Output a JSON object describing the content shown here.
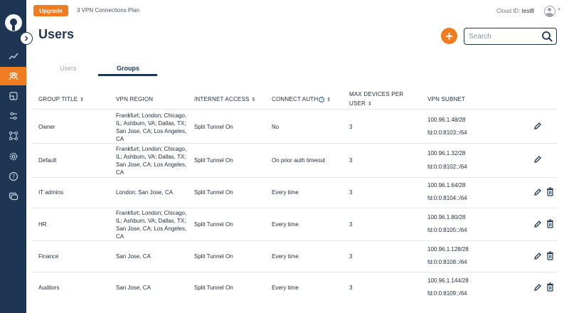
{
  "topbar": {
    "upgrade_label": "Upgrade",
    "plan_text": "3 VPN Connections Plan",
    "cloud_id_label": "Cloud ID:",
    "cloud_id_value": "test8"
  },
  "page": {
    "title": "Users"
  },
  "search": {
    "placeholder": "Search"
  },
  "tabs": [
    {
      "label": "Users",
      "active": false
    },
    {
      "label": "Groups",
      "active": true
    }
  ],
  "sidebar": {
    "items": [
      {
        "icon": "analytics-icon",
        "active": false
      },
      {
        "icon": "users-icon",
        "active": true
      },
      {
        "icon": "access-icon",
        "active": false
      },
      {
        "icon": "settings-sliders-icon",
        "active": false
      },
      {
        "icon": "network-icon",
        "active": false
      },
      {
        "icon": "gear-icon",
        "active": false
      },
      {
        "icon": "help-icon",
        "active": false
      },
      {
        "icon": "support-chat-icon",
        "active": false
      }
    ]
  },
  "table": {
    "columns": [
      "GROUP TITLE",
      "VPN REGION",
      "INTERNET ACCESS",
      "CONNECT AUTH",
      "MAX DEVICES PER",
      "USER",
      "VPN SUBNET"
    ],
    "rows": [
      {
        "title": "Owner",
        "region": "Frankfurt; London; Chicago, IL; Ashburn, VA; Dallas, TX; San Jose, CA; Los Angeles, CA",
        "internet": "Split Tunnel On",
        "auth": "No",
        "max": "3",
        "subnet_v4": "100.96.1.48/28",
        "subnet_v6": "fd:0:0:8103::/64",
        "deletable": false
      },
      {
        "title": "Default",
        "region": "Frankfurt; London; Chicago, IL; Ashburn, VA; Dallas, TX; San Jose, CA; Los Angeles, CA",
        "internet": "Split Tunnel On",
        "auth": "On prior auth timeout",
        "max": "3",
        "subnet_v4": "100.96.1.32/28",
        "subnet_v6": "fd:0:0:8102::/64",
        "deletable": false
      },
      {
        "title": "IT admins",
        "region": "London; San Jose, CA",
        "internet": "Split Tunnel On",
        "auth": "Every time",
        "max": "3",
        "subnet_v4": "100.96.1.64/28",
        "subnet_v6": "fd:0:0:8104::/64",
        "deletable": true
      },
      {
        "title": "HR",
        "region": "Frankfurt; London; Chicago, IL; Ashburn, VA; Dallas, TX; San Jose, CA; Los Angeles, CA",
        "internet": "Split Tunnel On",
        "auth": "Every time",
        "max": "3",
        "subnet_v4": "100.96.1.80/28",
        "subnet_v6": "fd:0:0:8105::/64",
        "deletable": true
      },
      {
        "title": "Finance",
        "region": "San Jose, CA",
        "internet": "Split Tunnel On",
        "auth": "Every time",
        "max": "3",
        "subnet_v4": "100.96.1.128/28",
        "subnet_v6": "fd:0:0:8108::/64",
        "deletable": true
      },
      {
        "title": "Auditors",
        "region": "San Jose, CA",
        "internet": "Split Tunnel On",
        "auth": "Every time",
        "max": "3",
        "subnet_v4": "100.96.1.144/28",
        "subnet_v6": "fd:0:0:8109::/64",
        "deletable": true
      }
    ]
  },
  "colors": {
    "accent": "#f07c22",
    "sidebar": "#1e3654",
    "text": "#1c2b3a"
  }
}
